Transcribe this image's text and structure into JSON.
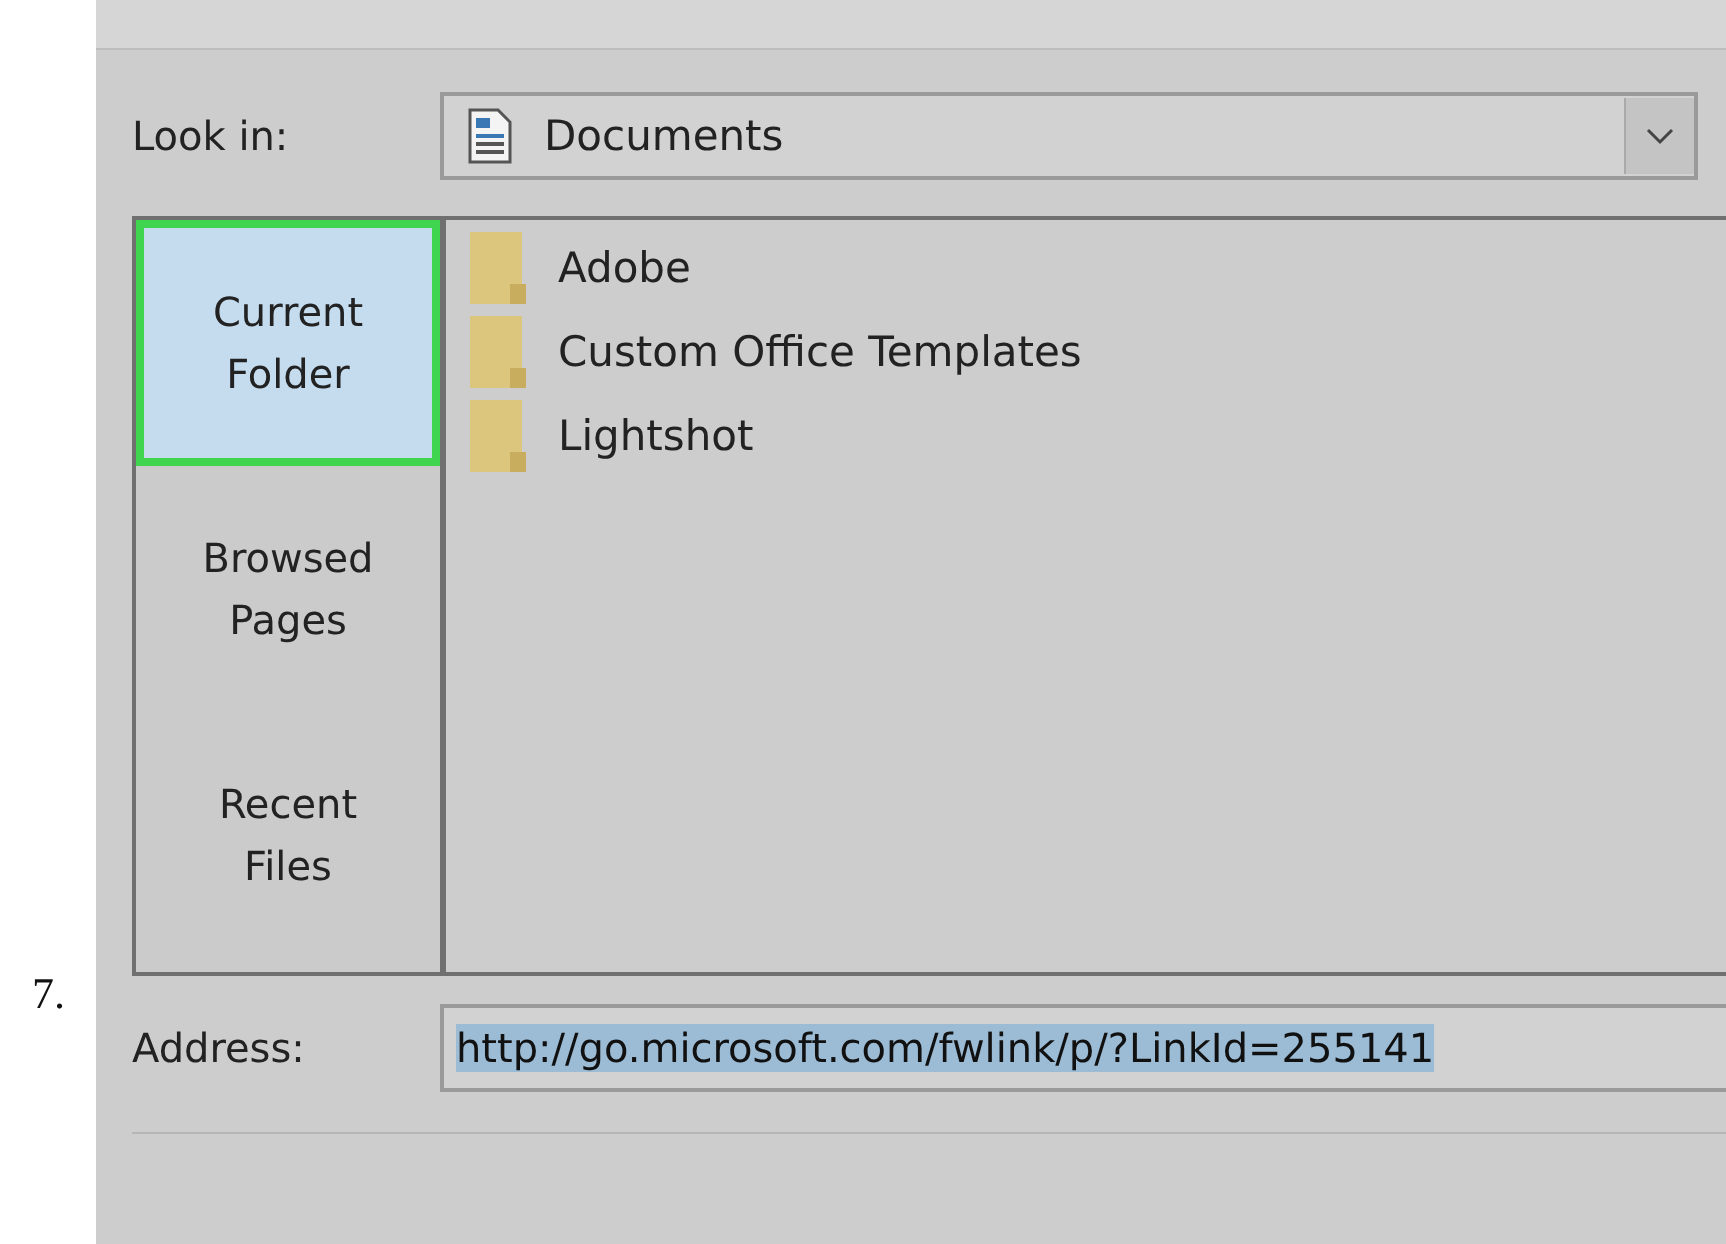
{
  "step_number": "7.",
  "look_in": {
    "label": "Look in:",
    "value": "Documents"
  },
  "places": [
    {
      "label": "Current Folder",
      "selected": true
    },
    {
      "label": "Browsed Pages",
      "selected": false
    },
    {
      "label": "Recent Files",
      "selected": false
    }
  ],
  "files": [
    {
      "name": "Adobe"
    },
    {
      "name": "Custom Office Templates"
    },
    {
      "name": "Lightshot"
    }
  ],
  "address": {
    "label": "Address:",
    "value": "http://go.microsoft.com/fwlink/p/?LinkId=255141",
    "text_selected": true
  }
}
